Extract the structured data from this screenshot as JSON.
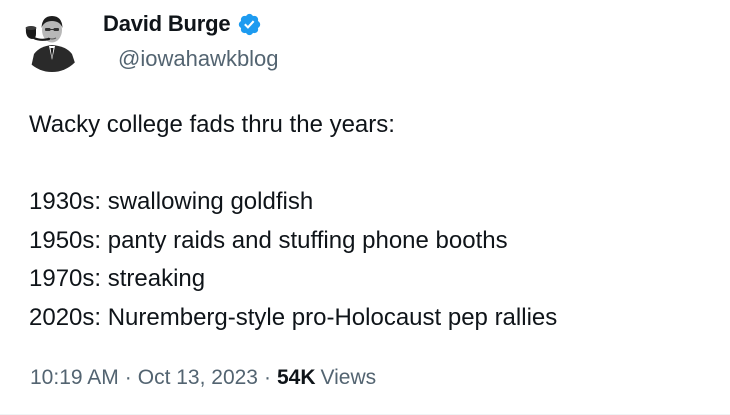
{
  "author": {
    "display_name": "David Burge",
    "handle": "@iowahawkblog",
    "verified": true,
    "avatar_icon": "black-and-white-portrait-with-pipe"
  },
  "tweet": {
    "lines": [
      "Wacky college fads thru the years:",
      "",
      "1930s: swallowing goldfish",
      "1950s: panty raids and stuffing phone booths",
      "1970s: streaking",
      "2020s: Nuremberg-style pro-Holocaust pep rallies"
    ]
  },
  "meta": {
    "time": "10:19 AM",
    "separator": "·",
    "date": "Oct 13, 2023",
    "views_count": "54K",
    "views_label": "Views"
  },
  "colors": {
    "text_primary": "#0f1419",
    "text_secondary": "#536471",
    "verified_blue": "#1d9bf0"
  }
}
